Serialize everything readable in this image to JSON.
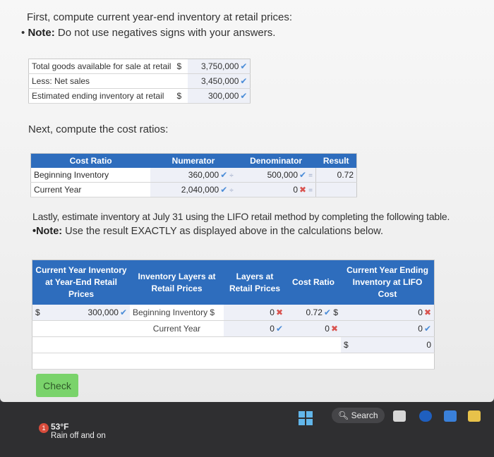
{
  "instructions": {
    "line1": "First, compute current year-end inventory at retail prices:",
    "bullet": "•",
    "note_label": "Note:",
    "note_text": " Do not use negatives signs with your answers.",
    "line3": "Next, compute the cost ratios:",
    "line6": "Lastly, estimate inventory at July 31 using the LIFO retail method by completing the following table.",
    "note2_label": "•Note:",
    "note2_text": " Use the result EXACTLY as displayed above in the calculations below."
  },
  "table1": {
    "rows": [
      {
        "label": "Total goods available for sale at retail",
        "currency": "$",
        "value": "3,750,000"
      },
      {
        "label": "Less: Net sales",
        "currency": "",
        "value": "3,450,000"
      },
      {
        "label": "Estimated ending inventory at retail",
        "currency": "$",
        "value": "300,000"
      }
    ]
  },
  "table2": {
    "headers": [
      "Cost Ratio",
      "Numerator",
      "Denominator",
      "Result"
    ],
    "rows": [
      {
        "label": "Beginning Inventory",
        "numerator": "360,000",
        "denominator": "500,000",
        "result": "0.72"
      },
      {
        "label": "Current Year",
        "numerator": "2,040,000",
        "denominator": "0",
        "result": ""
      }
    ],
    "div_op": "÷",
    "eq_op": "="
  },
  "table3": {
    "headers": [
      "Current Year Inventory at Year-End Retail Prices",
      "Inventory Layers at Retail Prices",
      "Layers at Retail Prices",
      "Cost Ratio",
      "Current Year Ending Inventory at LIFO Cost"
    ],
    "retail_currency": "$",
    "retail_value": "300,000",
    "layer1_label": "Beginning Inventory",
    "layer1_currency": "$",
    "layer1_value": "0",
    "layer1_ratio": "0.72",
    "layer1_ratio_currency": "$",
    "layer1_cost": "0",
    "layer2_label": "Current Year",
    "layer2_value": "0",
    "layer2_ratio": "0",
    "layer2_cost": "0",
    "total_currency": "$",
    "total_cost": "0"
  },
  "check_button": "Check",
  "taskbar": {
    "notification_count": "1",
    "temperature": "53°F",
    "weather": "Rain off and on",
    "search_label": "Search"
  },
  "colors": {
    "header_blue": "#2e6dbd",
    "check_green": "#7ad36b",
    "correct_mark": "#4a8cd8",
    "wrong_mark": "#d9534f"
  }
}
